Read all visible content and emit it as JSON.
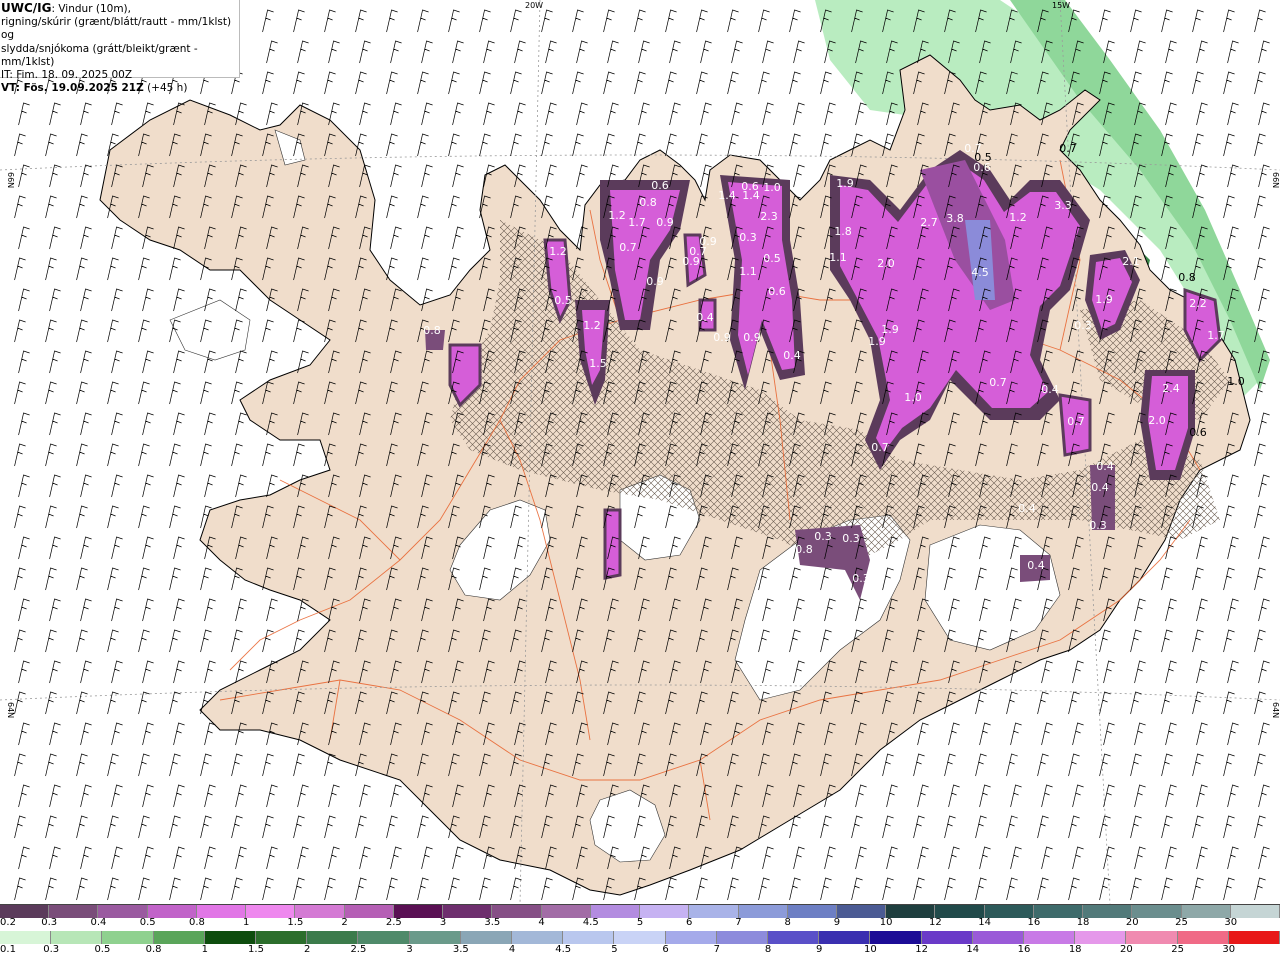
{
  "header": {
    "product": "UWC/IG",
    "title_rest": ": Vindur (10m),",
    "line2": "rigning/skúrir (grænt/blátt/rautt - mm/1klst) og",
    "line3": "slydda/snjókoma (grátt/bleikt/grænt - mm/1klst)",
    "line4": "IT: Fim. 18. 09. 2025 00Z",
    "line5_bold": "VT: Fös. 19.09.2025 21Z",
    "line5_rest": " (+45 h)"
  },
  "grid_labels": {
    "top_20w": "20W",
    "top_15w": "15W",
    "left_66n": "66N",
    "right_66n": "66N",
    "left_64n": "64N",
    "right_64n": "64N"
  },
  "precip_labels": [
    {
      "t": "0.6",
      "dark": false
    },
    {
      "t": "1.2",
      "dark": false
    },
    {
      "t": "0.8",
      "dark": false
    },
    {
      "t": "1.7",
      "dark": false
    },
    {
      "t": "0.9",
      "dark": false
    },
    {
      "t": "0.7",
      "dark": false
    },
    {
      "t": "0.9",
      "dark": false
    },
    {
      "t": "0.9",
      "dark": false
    },
    {
      "t": "0.9",
      "dark": false
    },
    {
      "t": "1.2",
      "dark": false
    },
    {
      "t": "1.5",
      "dark": false
    },
    {
      "t": "1.2",
      "dark": false
    },
    {
      "t": "0.5",
      "dark": false
    },
    {
      "t": "1.4",
      "dark": false
    },
    {
      "t": "0.6",
      "dark": false
    },
    {
      "t": "1.4",
      "dark": false
    },
    {
      "t": "1.0",
      "dark": false
    },
    {
      "t": "0.7",
      "dark": false
    },
    {
      "t": "2.3",
      "dark": false
    },
    {
      "t": "0.3",
      "dark": false
    },
    {
      "t": "1.1",
      "dark": false
    },
    {
      "t": "0.5",
      "dark": false
    },
    {
      "t": "0.6",
      "dark": false
    },
    {
      "t": "0.9",
      "dark": false
    },
    {
      "t": "0.4",
      "dark": false
    },
    {
      "t": "1.9",
      "dark": false
    },
    {
      "t": "1.8",
      "dark": false
    },
    {
      "t": "1.1",
      "dark": false
    },
    {
      "t": "2.0",
      "dark": false
    },
    {
      "t": "1.9",
      "dark": false
    },
    {
      "t": "1.9",
      "dark": false
    },
    {
      "t": "2.7",
      "dark": false
    },
    {
      "t": "3.8",
      "dark": false
    },
    {
      "t": "4.5",
      "dark": false
    },
    {
      "t": "1.2",
      "dark": false
    },
    {
      "t": "3.3",
      "dark": false
    },
    {
      "t": "0.7",
      "dark": false
    },
    {
      "t": "0.5",
      "dark": true
    },
    {
      "t": "0.6",
      "dark": false
    },
    {
      "t": "0.7",
      "dark": true
    },
    {
      "t": "2.1",
      "dark": false
    },
    {
      "t": "1.9",
      "dark": false
    },
    {
      "t": "0.3",
      "dark": false
    },
    {
      "t": "0.8",
      "dark": true
    },
    {
      "t": "2.2",
      "dark": false
    },
    {
      "t": "1.7",
      "dark": false
    },
    {
      "t": "1.0",
      "dark": true
    },
    {
      "t": "2.4",
      "dark": false
    },
    {
      "t": "2.0",
      "dark": false
    },
    {
      "t": "0.6",
      "dark": true
    },
    {
      "t": "1.0",
      "dark": false
    },
    {
      "t": "0.7",
      "dark": false
    },
    {
      "t": "0.7",
      "dark": false
    },
    {
      "t": "0.4",
      "dark": false
    },
    {
      "t": "0.7",
      "dark": false
    },
    {
      "t": "0.4",
      "dark": false
    },
    {
      "t": "0.4",
      "dark": false
    },
    {
      "t": "0.4",
      "dark": false
    },
    {
      "t": "0.3",
      "dark": false
    },
    {
      "t": "0.8",
      "dark": false
    },
    {
      "t": "0.3",
      "dark": false
    },
    {
      "t": "0.3",
      "dark": false
    },
    {
      "t": "0.3",
      "dark": false
    },
    {
      "t": "0.4",
      "dark": false
    },
    {
      "t": "0.8",
      "dark": false
    },
    {
      "t": "0.4",
      "dark": false
    },
    {
      "t": "0.9",
      "dark": false
    }
  ],
  "legend_snow": {
    "labels": [
      "0.2",
      "0.3",
      "0.4",
      "0.5",
      "0.8",
      "1",
      "1.5",
      "2",
      "2.5",
      "3",
      "3.5",
      "4",
      "4.5",
      "5",
      "6",
      "7",
      "8",
      "9",
      "10",
      "12",
      "14",
      "16",
      "18",
      "20",
      "25",
      "30"
    ],
    "colors": [
      "#5b3b5b",
      "#7a4d7a",
      "#9a5aa0",
      "#c163c9",
      "#e176e6",
      "#ee88ee",
      "#d47ad4",
      "#b55fb5",
      "#5a1054",
      "#6e2f6e",
      "#864f86",
      "#a26ca6",
      "#b38ce0",
      "#c6b2f2",
      "#a9b3e8",
      "#8c9bd9",
      "#6d7fc4",
      "#4b5b94",
      "#1f3f3f",
      "#214a4a",
      "#2d5a5a",
      "#3e6b6b",
      "#527a7a",
      "#6b8e8e",
      "#8ea8a8",
      "#c5d5d5"
    ]
  },
  "legend_rain": {
    "labels": [
      "0.1",
      "0.3",
      "0.5",
      "0.8",
      "1",
      "1.5",
      "2",
      "2.5",
      "3",
      "3.5",
      "4",
      "4.5",
      "5",
      "6",
      "7",
      "8",
      "9",
      "10",
      "12",
      "14",
      "16",
      "18",
      "20",
      "25",
      "30"
    ],
    "colors": [
      "#d7f5d7",
      "#b7e6b7",
      "#8fd18f",
      "#5aa55a",
      "#0e4d0e",
      "#2c6e2c",
      "#3b7b4b",
      "#4f8a6a",
      "#6a9a8a",
      "#8aa6b6",
      "#a3b8d8",
      "#b9c7ee",
      "#c9d3f6",
      "#a5aaea",
      "#8d8bdc",
      "#5a50c8",
      "#3a2fb0",
      "#1c0c96",
      "#6a3ac8",
      "#9a5ad8",
      "#c87ae6",
      "#e598ea",
      "#f08ab0",
      "#f06a86",
      "#e81818"
    ]
  }
}
